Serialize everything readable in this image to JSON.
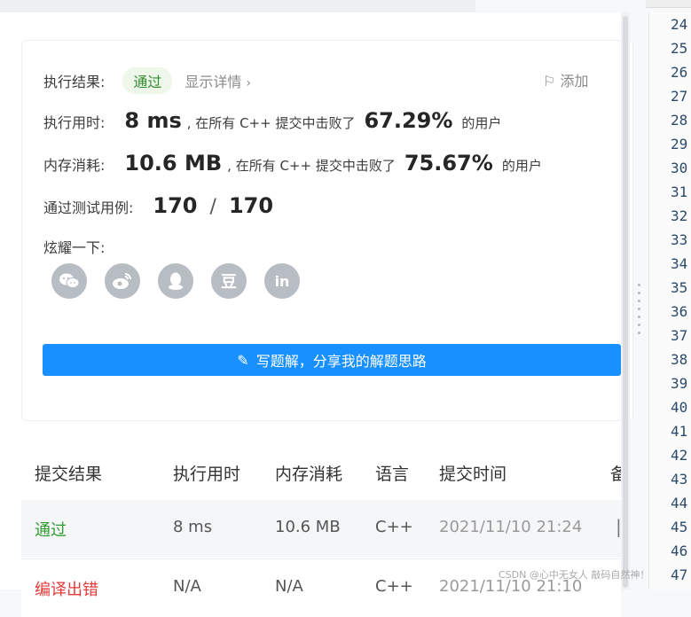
{
  "result": {
    "status_label": "执行结果:",
    "status_badge": "通过",
    "details_link": "显示详情",
    "add_note": "添加",
    "runtime": {
      "label": "执行用时:",
      "value": "8 ms",
      "text_before": ", 在所有 C++ 提交中击败了",
      "percent": "67.29%",
      "text_after": "的用户"
    },
    "memory": {
      "label": "内存消耗:",
      "value": "10.6 MB",
      "text_before": ", 在所有 C++ 提交中击败了",
      "percent": "75.67%",
      "text_after": "的用户"
    },
    "testcases": {
      "label": "通过测试用例:",
      "passed": "170",
      "separator": "/",
      "total": "170"
    },
    "share": {
      "label": "炫耀一下:",
      "icons": [
        "wechat-icon",
        "weibo-icon",
        "qq-icon",
        "douban-icon",
        "linkedin-icon"
      ],
      "douban_glyph": "豆",
      "linkedin_glyph": "in"
    },
    "write_solution_button": "写题解，分享我的解题思路"
  },
  "submissions": {
    "headers": [
      "提交结果",
      "执行用时",
      "内存消耗",
      "语言",
      "提交时间",
      "备"
    ],
    "rows": [
      {
        "result": "通过",
        "runtime": "8 ms",
        "memory": "10.6 MB",
        "language": "C++",
        "time": "2021/11/10 21:24"
      },
      {
        "result": "编译出错",
        "runtime": "N/A",
        "memory": "N/A",
        "language": "C++",
        "time": "2021/11/10 21:10"
      }
    ]
  },
  "editor": {
    "line_numbers": [
      "24",
      "25",
      "26",
      "27",
      "28",
      "29",
      "30",
      "31",
      "32",
      "33",
      "34",
      "35",
      "36",
      "37",
      "38",
      "39",
      "40",
      "41",
      "42",
      "43",
      "44",
      "45",
      "46",
      "47"
    ]
  },
  "watermark": "CSDN @心中无女人 敲码自然神！",
  "colors": {
    "accent": "#1890ff",
    "pass": "#2f9b2f",
    "error": "#e23b3b"
  }
}
